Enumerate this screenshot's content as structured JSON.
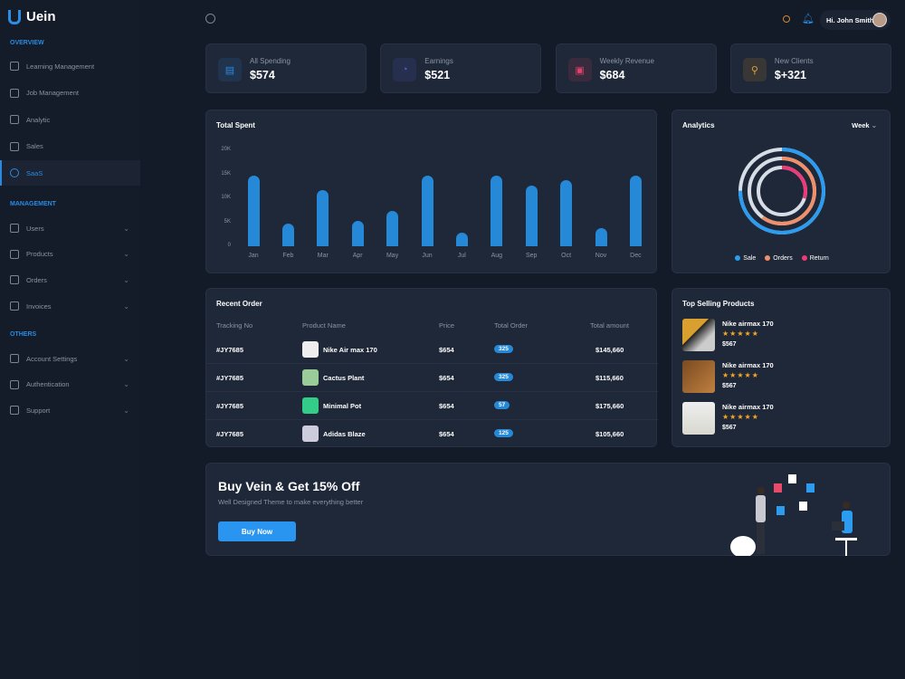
{
  "brand": "Uein",
  "sidebar": {
    "overview_label": "OVERVIEW",
    "overview": [
      {
        "label": "Learning Management"
      },
      {
        "label": "Job Management"
      },
      {
        "label": "Analytic"
      },
      {
        "label": "Sales"
      },
      {
        "label": "SaaS",
        "active": true
      }
    ],
    "management_label": "MANAGEMENT",
    "management": [
      {
        "label": "Users"
      },
      {
        "label": "Products"
      },
      {
        "label": "Orders"
      },
      {
        "label": "Invoices"
      }
    ],
    "others_label": "OTHERS",
    "others": [
      {
        "label": "Account Settings"
      },
      {
        "label": "Authentication"
      },
      {
        "label": "Support"
      }
    ]
  },
  "header": {
    "greeting": "Hi. John Smith"
  },
  "stats": [
    {
      "label": "All Spending",
      "value": "$574",
      "icon": "wallet-icon",
      "color": "#2a8ae0"
    },
    {
      "label": "Earnings",
      "value": "$521",
      "icon": "pie-chart-icon",
      "color": "#5a5ee0"
    },
    {
      "label": "Weekly Revenue",
      "value": "$684",
      "icon": "money-icon",
      "color": "#e0406a"
    },
    {
      "label": "New Clients",
      "value": "$+321",
      "icon": "user-plus-icon",
      "color": "#e0a030"
    }
  ],
  "chart_data": {
    "type": "bar",
    "title": "Total Spent",
    "categories": [
      "Jan",
      "Feb",
      "Mar",
      "Apr",
      "May",
      "Jun",
      "Jul",
      "Aug",
      "Sep",
      "Oct",
      "Nov",
      "Dec"
    ],
    "values": [
      14.7,
      4.7,
      11.7,
      5.3,
      7.3,
      14.7,
      2.8,
      14.7,
      12.7,
      13.7,
      3.8,
      14.7
    ],
    "yticks": [
      "0",
      "5K",
      "10K",
      "15K",
      "20K"
    ],
    "ylim": [
      0,
      20
    ],
    "color": "#2589d8"
  },
  "analytics": {
    "title": "Analytics",
    "period": "Week",
    "series": [
      {
        "name": "Sale",
        "value": 75,
        "color": "#2c9cf0"
      },
      {
        "name": "Orders",
        "value": 60,
        "color": "#f0906a"
      },
      {
        "name": "Return",
        "value": 30,
        "color": "#ee3a78"
      }
    ]
  },
  "orders": {
    "title": "Recent Order",
    "headers": [
      "Tracking No",
      "Product Name",
      "Price",
      "Total Order",
      "Total amount"
    ],
    "rows": [
      {
        "tracking": "#JY7685",
        "product": "Nike Air max 170",
        "price": "$654",
        "total": "325",
        "amount": "$145,660"
      },
      {
        "tracking": "#JY7685",
        "product": "Cactus Plant",
        "price": "$654",
        "total": "325",
        "amount": "$115,660"
      },
      {
        "tracking": "#JY7685",
        "product": "Minimal Pot",
        "price": "$654",
        "total": "57",
        "amount": "$175,660"
      },
      {
        "tracking": "#JY7685",
        "product": "Adidas Blaze",
        "price": "$654",
        "total": "125",
        "amount": "$105,660"
      }
    ]
  },
  "top": {
    "title": "Top Selling Products",
    "items": [
      {
        "name": "Nike airmax 170",
        "stars": "★★★★★",
        "rating": 5,
        "price": "$567"
      },
      {
        "name": "Nike airmax 170",
        "stars": "★★★★★",
        "rating": 5,
        "price": "$567"
      },
      {
        "name": "Nike airmax 170",
        "stars": "★★★★★",
        "rating": 5,
        "price": "$567"
      }
    ]
  },
  "promo": {
    "title": "Buy Vein & Get 15% Off",
    "subtitle": "Well Designed Theme to make everything better",
    "button": "Buy Now"
  }
}
